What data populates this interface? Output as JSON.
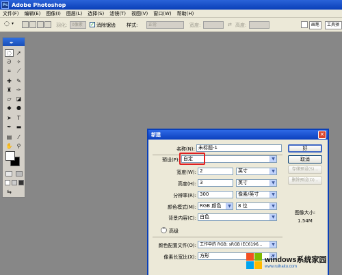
{
  "window": {
    "title": "Adobe Photoshop",
    "logo_text": "Ps"
  },
  "menu": [
    "文件(F)",
    "编辑(E)",
    "图像(I)",
    "图层(L)",
    "选择(S)",
    "滤镜(T)",
    "视图(V)",
    "窗口(W)",
    "帮助(H)"
  ],
  "options": {
    "feather_label": "羽化:",
    "feather_value": "0像素",
    "antialias_label": "消除锯齿",
    "style_label": "样式:",
    "style_value": "正常",
    "width_label": "宽度:",
    "height_label": "高度:",
    "tab_brushes": "画笔",
    "tab_tools": "工具预"
  },
  "dialog": {
    "title": "新建",
    "name_label": "名称(N):",
    "name_value": "未标题-1",
    "preset_label": "预设(P):",
    "preset_value": "自定",
    "width_label": "宽度(W):",
    "width_value": "2",
    "width_unit": "英寸",
    "height_label": "高度(H):",
    "height_value": "3",
    "height_unit": "英寸",
    "resolution_label": "分辨率(R):",
    "resolution_value": "300",
    "resolution_unit": "像素/英寸",
    "mode_label": "颜色模式(M):",
    "mode_value": "RGB 颜色",
    "bit_value": "8 位",
    "bg_label": "背景内容(C):",
    "bg_value": "白色",
    "advanced_label": "高级",
    "profile_label": "颜色配置文件(O):",
    "profile_value": "工作中的 RGB: sRGB IEC6196...",
    "pixel_aspect_label": "像素长宽比(X):",
    "pixel_aspect_value": "方形",
    "ok_button": "好",
    "cancel_button": "取消",
    "save_preset_button": "存储预设(S)...",
    "delete_preset_button": "删除预设(D)...",
    "image_size_label": "图像大小:",
    "image_size_value": "1.54M"
  },
  "watermark": {
    "line1": "windows系统家园",
    "line2": "www.ruihaitu.com"
  },
  "colors": {
    "titlebar": "#0a3fb8",
    "workspace": "#878787",
    "dialog_bg": "#ece9d8",
    "highlight": "#e02020"
  }
}
